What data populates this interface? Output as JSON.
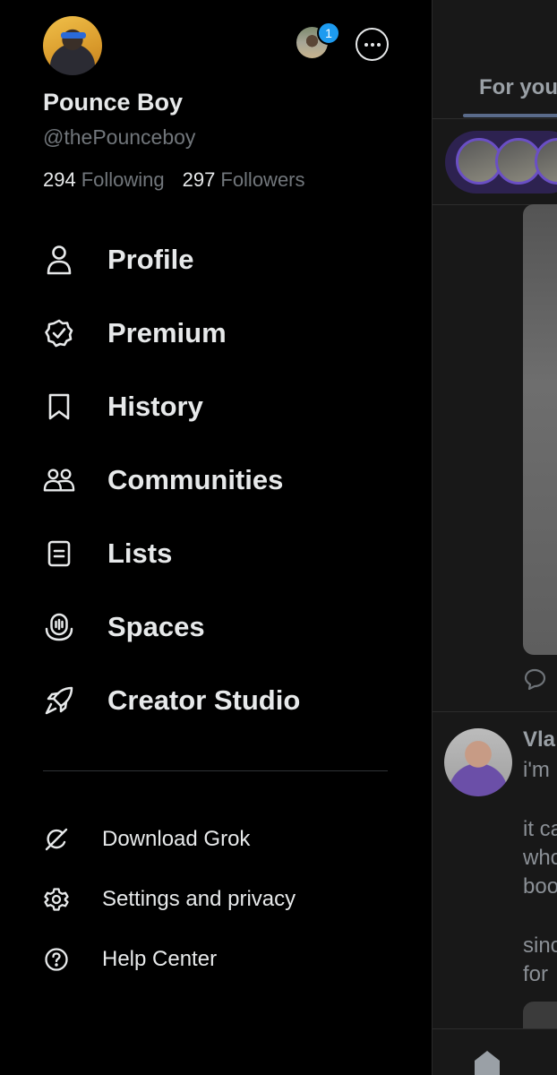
{
  "profile": {
    "name": "Pounce Boy",
    "handle": "@thePounceboy",
    "following_count": "294",
    "following_label": "Following",
    "followers_count": "297",
    "followers_label": "Followers",
    "notification_badge": "1"
  },
  "nav": {
    "items": [
      {
        "label": "Profile",
        "icon": "person-icon"
      },
      {
        "label": "Premium",
        "icon": "verified-badge-icon"
      },
      {
        "label": "History",
        "icon": "bookmark-icon"
      },
      {
        "label": "Communities",
        "icon": "communities-icon"
      },
      {
        "label": "Lists",
        "icon": "list-icon"
      },
      {
        "label": "Spaces",
        "icon": "spaces-icon"
      },
      {
        "label": "Creator Studio",
        "icon": "rocket-icon"
      }
    ]
  },
  "secondary": {
    "items": [
      {
        "label": "Download Grok",
        "icon": "grok-icon"
      },
      {
        "label": "Settings and privacy",
        "icon": "gear-icon"
      },
      {
        "label": "Help Center",
        "icon": "help-icon"
      }
    ]
  },
  "feed": {
    "tab_label": "For you",
    "post_author": "Vla",
    "post_lines": [
      "i'm",
      "it ca",
      "who",
      "boo",
      "sinc",
      "for"
    ]
  }
}
